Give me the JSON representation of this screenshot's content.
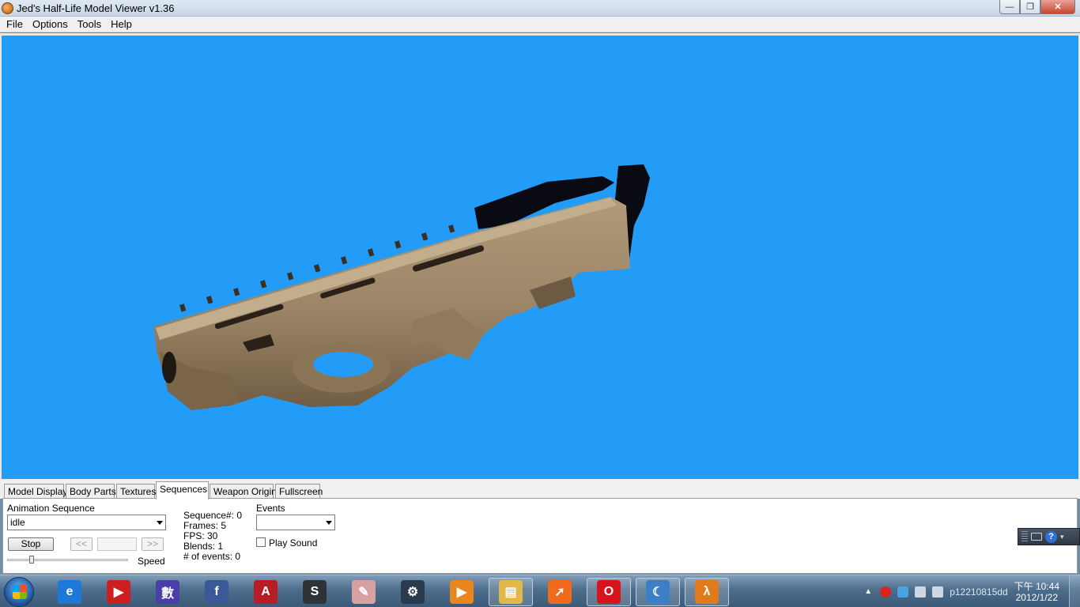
{
  "window": {
    "title": "Jed's Half-Life Model Viewer v1.36"
  },
  "menu": [
    "File",
    "Options",
    "Tools",
    "Help"
  ],
  "colors": {
    "viewport_bg": "#239cf7",
    "model_body": "#a08a6c",
    "model_dark": "#0a0a12"
  },
  "tabs": [
    {
      "label": "Model Display",
      "active": false
    },
    {
      "label": "Body Parts",
      "active": false
    },
    {
      "label": "Textures",
      "active": false
    },
    {
      "label": "Sequences",
      "active": true
    },
    {
      "label": "Weapon Origin",
      "active": false
    },
    {
      "label": "Fullscreen",
      "active": false
    }
  ],
  "sequences": {
    "animation_label": "Animation Sequence",
    "selected": "idle",
    "stop_label": "Stop",
    "prev_label": "<<",
    "next_label": ">>",
    "speed_label": "Speed",
    "speed_value": 0.2,
    "info": {
      "sequence": "Sequence#: 0",
      "frames": "Frames: 5",
      "fps": "FPS: 30",
      "blends": "Blends: 1",
      "events": "# of events: 0"
    },
    "events_label": "Events",
    "events_selected": "",
    "play_sound_label": "Play Sound",
    "play_sound_checked": false
  },
  "langbar": {
    "help_label": "?"
  },
  "taskbar": {
    "apps": [
      {
        "name": "internet-explorer-icon",
        "glyph": "e",
        "color": "#1e78d8",
        "open": false
      },
      {
        "name": "youtube-icon",
        "glyph": "▶",
        "color": "#cc1f1f",
        "open": false
      },
      {
        "name": "math-app-icon",
        "glyph": "數",
        "color": "#4a3fa8",
        "open": false
      },
      {
        "name": "facebook-icon",
        "glyph": "f",
        "color": "#3b5998",
        "open": false
      },
      {
        "name": "autocad-icon",
        "glyph": "A",
        "color": "#b81d24",
        "open": false
      },
      {
        "name": "3dsmax-icon",
        "glyph": "S",
        "color": "#2f3338",
        "open": false
      },
      {
        "name": "anime-app-icon",
        "glyph": "✎",
        "color": "#d8a0a0",
        "open": false
      },
      {
        "name": "steam-icon",
        "glyph": "⚙",
        "color": "#2b3b4d",
        "open": false
      },
      {
        "name": "media-player-icon",
        "glyph": "▶",
        "color": "#e8871e",
        "open": false
      },
      {
        "name": "file-explorer-icon",
        "glyph": "▤",
        "color": "#e2b84a",
        "open": true
      },
      {
        "name": "arrow-app-icon",
        "glyph": "➚",
        "color": "#ef6a1c",
        "open": false
      },
      {
        "name": "opera-icon",
        "glyph": "O",
        "color": "#d7131c",
        "open": true
      },
      {
        "name": "moon-app-icon",
        "glyph": "☾",
        "color": "#3d7fc4",
        "open": true
      },
      {
        "name": "half-life-icon",
        "glyph": "λ",
        "color": "#e07a1a",
        "open": true
      }
    ],
    "tray_text": "p12210815dd",
    "time": "下午 10:44",
    "date": "2012/1/22"
  }
}
